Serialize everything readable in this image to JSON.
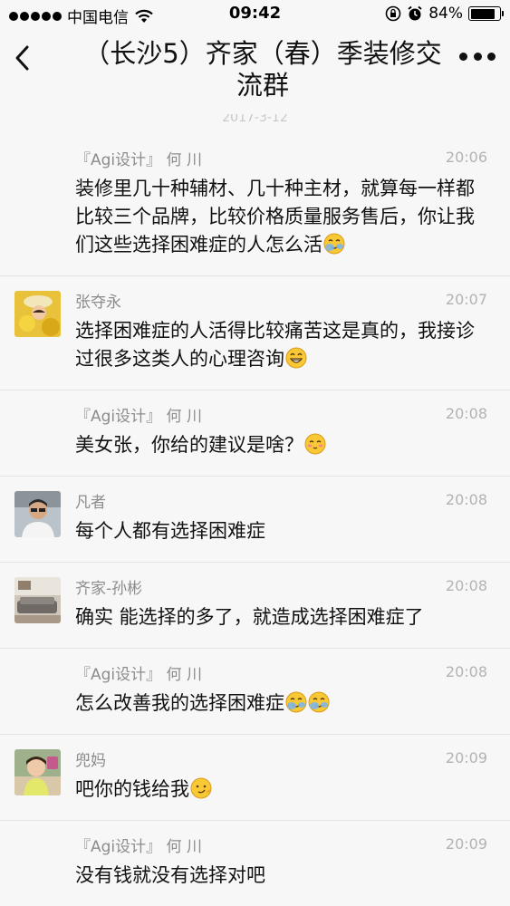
{
  "status_bar": {
    "carrier": "中国电信",
    "time": "09:42",
    "battery_percent": "84%",
    "battery_level": 0.84,
    "icons": [
      "signal-dots-icon",
      "wifi-icon",
      "rotation-lock-icon",
      "alarm-icon",
      "battery-icon"
    ]
  },
  "nav": {
    "title": "（长沙5）齐家（春）季装修交流群",
    "back_icon": "chevron-left-icon",
    "more_icon": "more-dots-icon"
  },
  "date_stamp": "2017-3-12",
  "messages": [
    {
      "sender": "『Agi设计』 何 川",
      "time": "20:06",
      "text": "装修里几十种辅材、几十种主材，就算每一样都比较三个品牌，比较价格质量服务售后，你让我们这些选择困难症的人怎么活",
      "emoji": [
        "facepalm-emoji"
      ],
      "avatar": null
    },
    {
      "sender": "张夺永",
      "time": "20:07",
      "text": "选择困难症的人活得比较痛苦这是真的，我接诊过很多这类人的心理咨询",
      "emoji": [
        "grin-emoji"
      ],
      "avatar": "avatar-yellow-flowers"
    },
    {
      "sender": "『Agi设计』 何 川",
      "time": "20:08",
      "text": "美女张，你给的建议是啥？",
      "emoji": [
        "blush-emoji"
      ],
      "avatar": null
    },
    {
      "sender": "凡者",
      "time": "20:08",
      "text": "每个人都有选择困难症",
      "emoji": [],
      "avatar": "avatar-man-glasses"
    },
    {
      "sender": "齐家-孙彬",
      "time": "20:08",
      "text": "确实  能选择的多了，就造成选择困难症了",
      "emoji": [],
      "avatar": "avatar-living-room"
    },
    {
      "sender": "『Agi设计』 何 川",
      "time": "20:08",
      "text": "怎么改善我的选择困难症",
      "emoji": [
        "facepalm-emoji",
        "facepalm-emoji"
      ],
      "avatar": null
    },
    {
      "sender": "兜妈",
      "time": "20:09",
      "text": "吧你的钱给我",
      "emoji": [
        "smirk-emoji"
      ],
      "avatar": "avatar-child"
    },
    {
      "sender": "『Agi设计』 何 川",
      "time": "20:09",
      "text": "没有钱就没有选择对吧",
      "emoji": [],
      "avatar": null
    }
  ]
}
